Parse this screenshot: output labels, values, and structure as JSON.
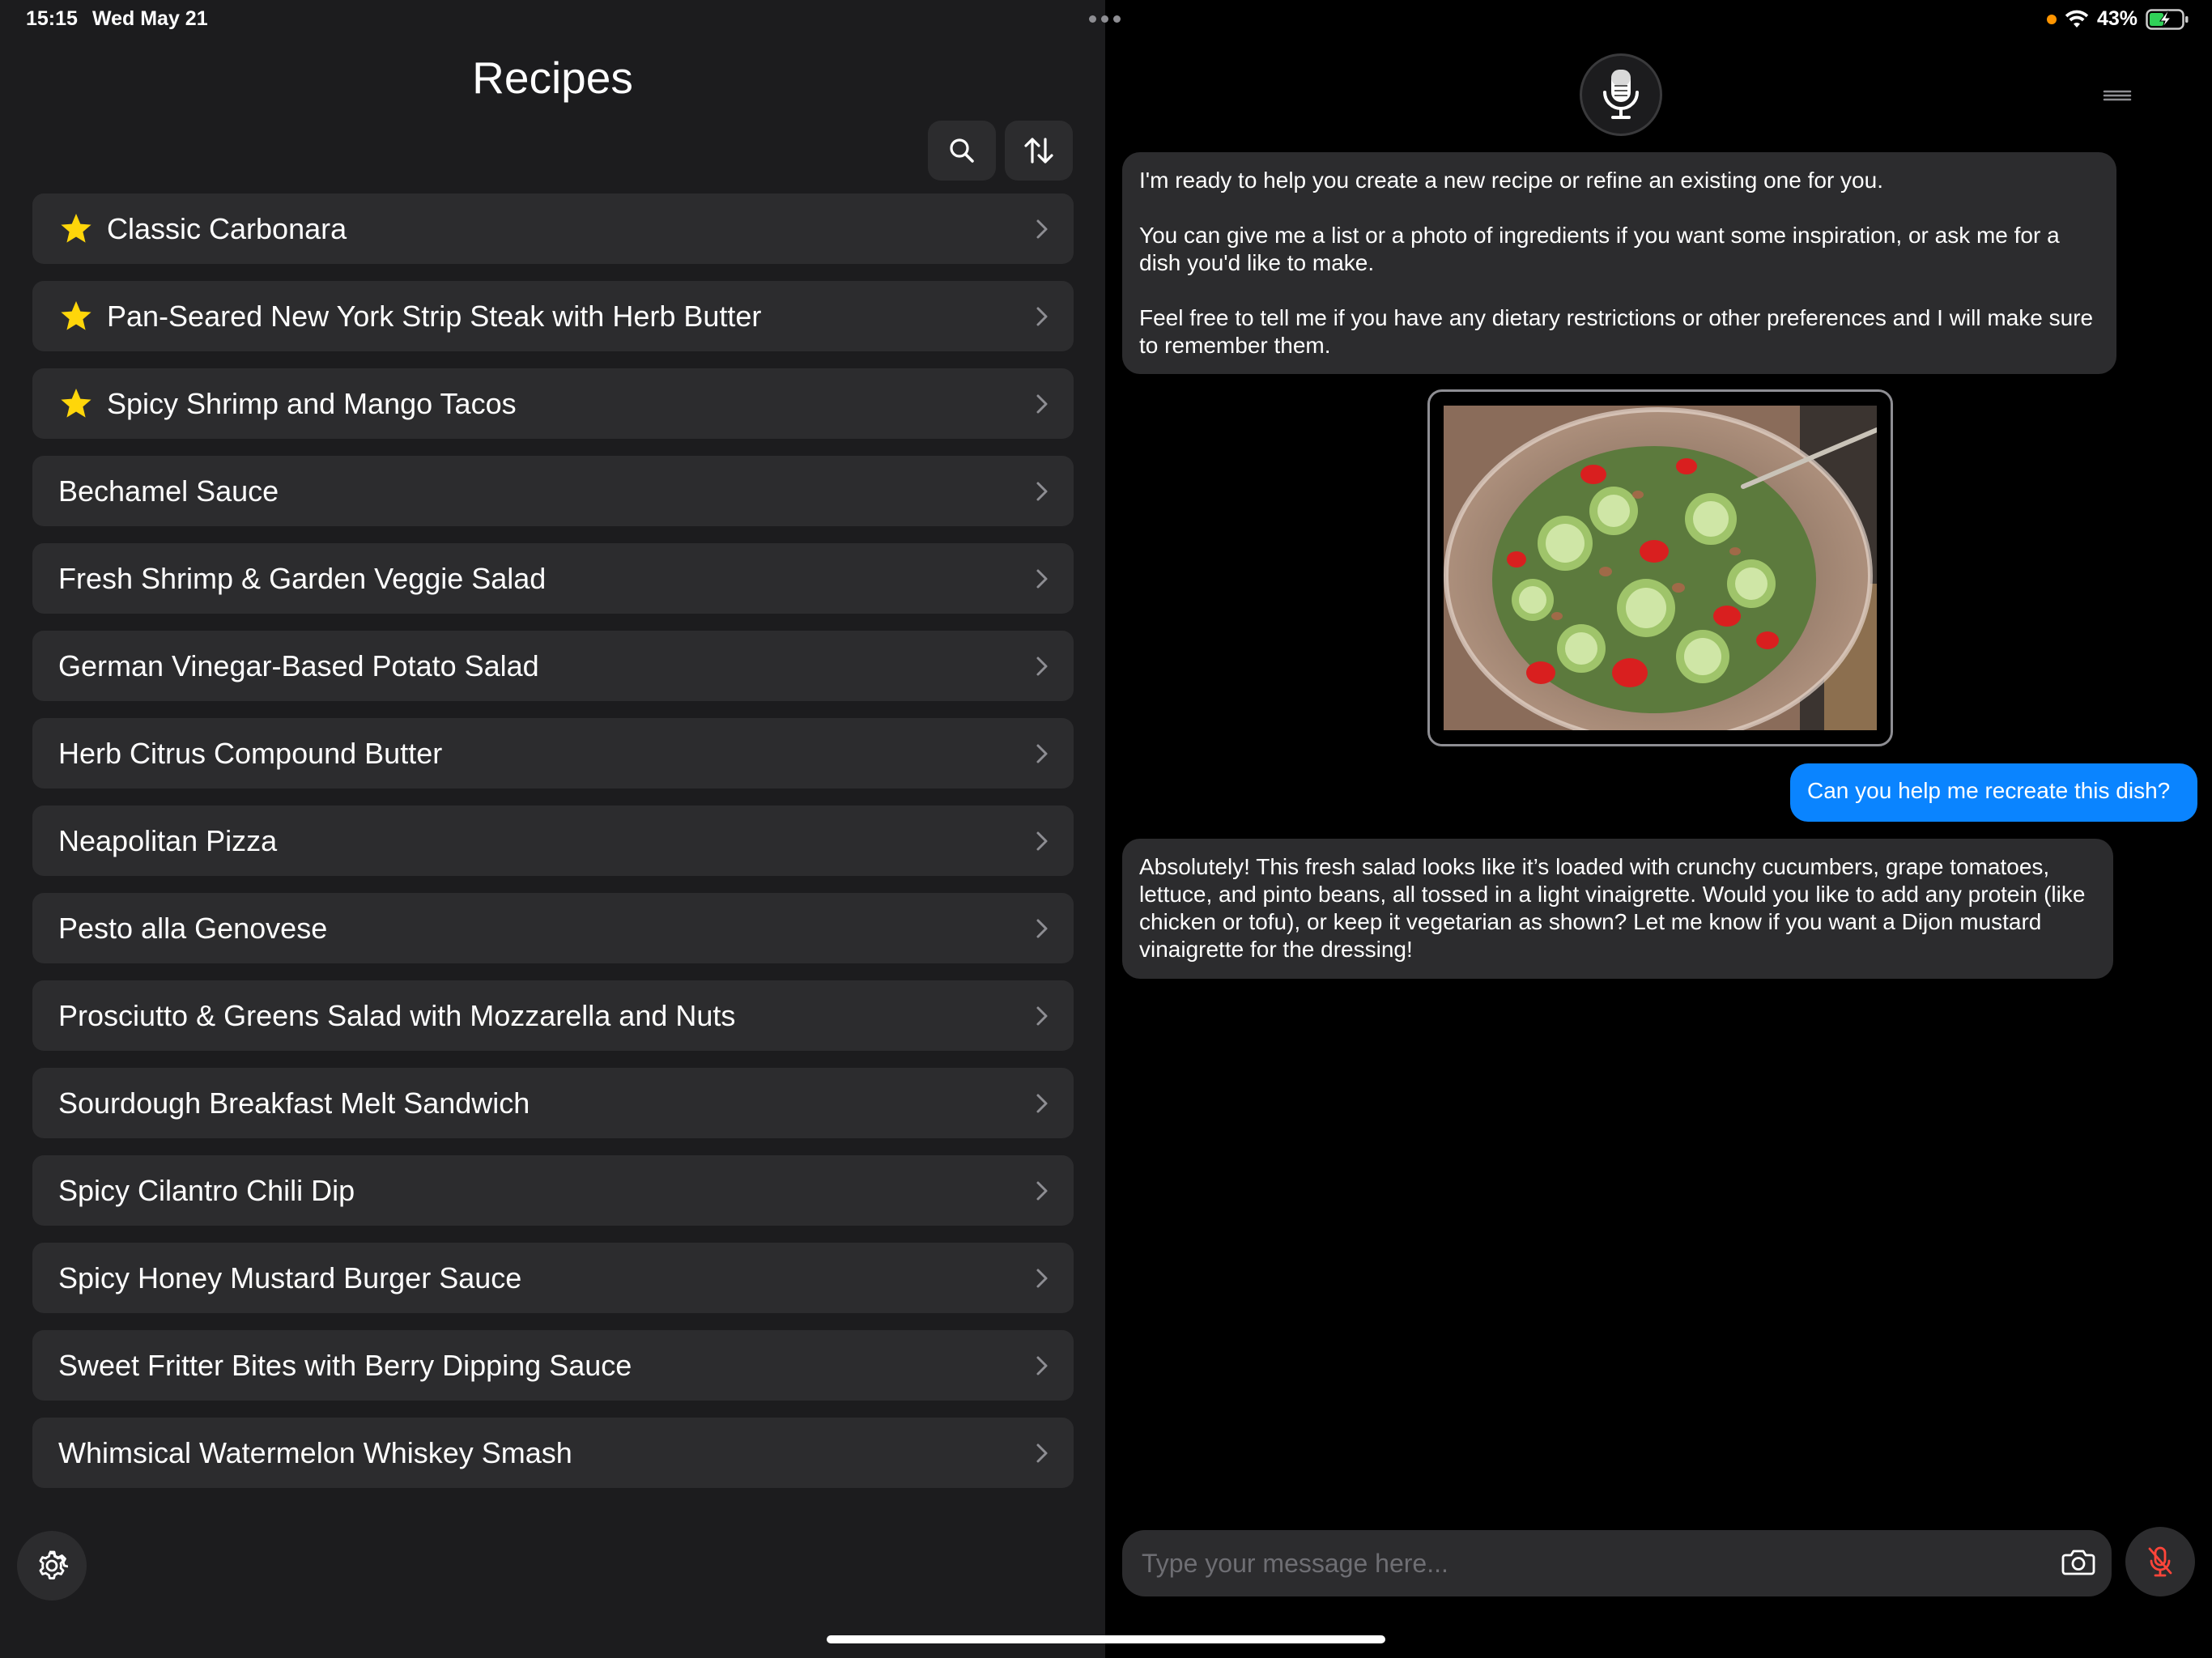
{
  "status_bar": {
    "time": "15:15",
    "date": "Wed May 21",
    "battery": "43%"
  },
  "recipes_pane": {
    "title": "Recipes",
    "recipes": [
      {
        "name": "Classic Carbonara",
        "favorite": true
      },
      {
        "name": "Pan-Seared New York Strip Steak with Herb Butter",
        "favorite": true
      },
      {
        "name": "Spicy Shrimp and Mango Tacos",
        "favorite": true
      },
      {
        "name": "Bechamel Sauce",
        "favorite": false
      },
      {
        "name": "Fresh Shrimp & Garden Veggie Salad",
        "favorite": false
      },
      {
        "name": "German Vinegar-Based Potato Salad",
        "favorite": false
      },
      {
        "name": "Herb Citrus Compound Butter",
        "favorite": false
      },
      {
        "name": "Neapolitan Pizza",
        "favorite": false
      },
      {
        "name": "Pesto alla Genovese",
        "favorite": false
      },
      {
        "name": "Prosciutto & Greens Salad with Mozzarella and Nuts",
        "favorite": false
      },
      {
        "name": "Sourdough Breakfast Melt Sandwich",
        "favorite": false
      },
      {
        "name": "Spicy Cilantro Chili Dip",
        "favorite": false
      },
      {
        "name": "Spicy Honey Mustard Burger Sauce",
        "favorite": false
      },
      {
        "name": "Sweet Fritter Bites with Berry Dipping Sauce",
        "favorite": false
      },
      {
        "name": "Whimsical Watermelon Whiskey Smash",
        "favorite": false
      }
    ]
  },
  "chat": {
    "messages": {
      "assistant_intro": [
        "I'm ready to help you create a new recipe or refine an existing one for you.",
        "You can give me a list or a photo of ingredients if you want some inspiration, or ask me for a dish you'd like to make.",
        "Feel free to tell me if you have any dietary restrictions or other preferences and I will make sure to remember them."
      ],
      "user_photo": {
        "subject": "salad-photo"
      },
      "user_text": "Can you help me recreate this dish?",
      "assistant_reply": "Absolutely! This fresh salad looks like it’s loaded with crunchy cucumbers, grape tomatoes, lettuce, and pinto beans, all tossed in a light vinaigrette. Would you like to add any protein (like chicken or tofu), or keep it vegetarian as shown? Let me know if you want a Dijon mustard vinaigrette for the dressing!"
    },
    "input": {
      "placeholder": "Type your message here...",
      "value": ""
    }
  },
  "colors": {
    "accent": "#0a84ff",
    "star": "#ffd60a",
    "mic_muted": "#ff453a",
    "battery_charging": "#30d158"
  }
}
